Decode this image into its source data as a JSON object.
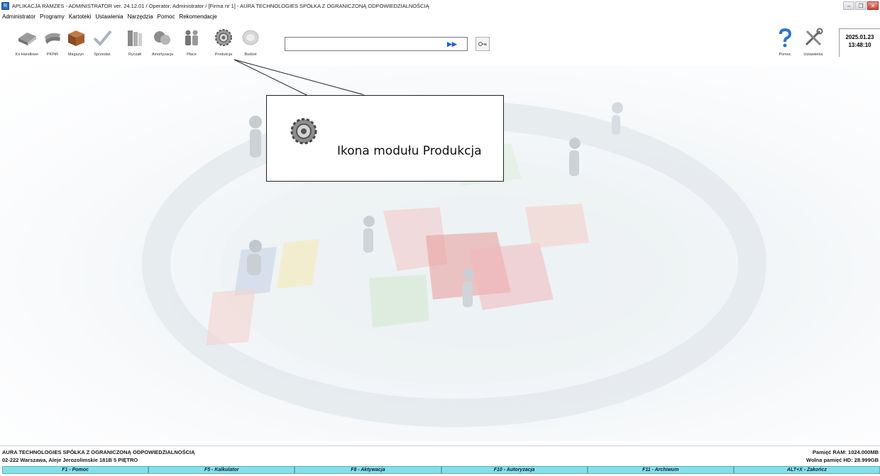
{
  "window": {
    "title": "APLIKACJA RAMZES - ADMINISTRATOR ver. 24.12.01 /  Operator: Administrator /  [Firma nr 1] - AURA TECHNOLOGIES SPÓŁKA Z OGRANICZONĄ ODPOWIEDZIALNOŚCIĄ"
  },
  "menu": [
    "Administrator",
    "Programy",
    "Kartoteki",
    "Ustawienia",
    "Narzędzia",
    "Pomoc",
    "Rekomendacje"
  ],
  "toolbar": {
    "modules": [
      {
        "label": "Ks.Handlowe",
        "icon": "book-icon"
      },
      {
        "label": "PKPiR",
        "icon": "papers-icon"
      },
      {
        "label": "Magazyn",
        "icon": "box-icon"
      },
      {
        "label": "Sprzedaż",
        "icon": "checkmark-icon"
      },
      {
        "label": "Ryczałt",
        "icon": "binders-icon"
      },
      {
        "label": "Amortyzacja",
        "icon": "coins-icon"
      },
      {
        "label": "Płace",
        "icon": "people-icon"
      },
      {
        "label": "Produkcja",
        "icon": "gear-icon"
      },
      {
        "label": "Budżet",
        "icon": "budget-icon"
      }
    ],
    "search_placeholder": "",
    "search_go": "▶▶",
    "right": [
      {
        "label": "Pomoc",
        "icon": "help-icon"
      },
      {
        "label": "Ustawienia",
        "icon": "tools-icon"
      }
    ]
  },
  "datetime": {
    "date": "2025.01.23",
    "time": "13:48:10"
  },
  "callout": {
    "text": "Ikona modułu Produkcja"
  },
  "status": {
    "company": "AURA TECHNOLOGIES SPÓŁKA Z OGRANICZONĄ ODPOWIEDZIALNOŚCIĄ",
    "address": "02-222 Warszawa, Aleje Jerozolimskie 181B 5 PIĘTRO",
    "ram": "Pamięć RAM: 1024.000MB",
    "hd": "Wolna pamięć HD: 28.999GB"
  },
  "fkeys": [
    "F1 - Pomoc",
    "F5 - Kalkulator",
    "F8 - Aktywacja",
    "F10 - Autoryzacja",
    "F11 - Archiwum",
    "ALT+X - Zakończ"
  ]
}
